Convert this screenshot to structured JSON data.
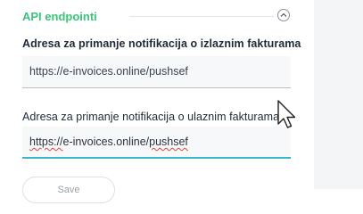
{
  "section": {
    "title": "API endpointi",
    "collapse_icon": "chevron-up-icon"
  },
  "fields": [
    {
      "label": "Adresa za primanje notifikacija o izlaznim fakturama",
      "value": "https://e-invoices.online/pushsef"
    },
    {
      "label": "Adresa za primanje notifikacija o ulaznim fakturama",
      "value_prefix": "https://",
      "value_mid": "e-invoices.online/",
      "value_suffix": "pushsef"
    }
  ],
  "actions": {
    "save_label": "Save"
  },
  "colors": {
    "accent_green": "#3cc47c",
    "focus_teal": "#3ab7c7",
    "spellcheck_red": "#e0453a"
  },
  "pointer": "arrow-cursor-icon"
}
